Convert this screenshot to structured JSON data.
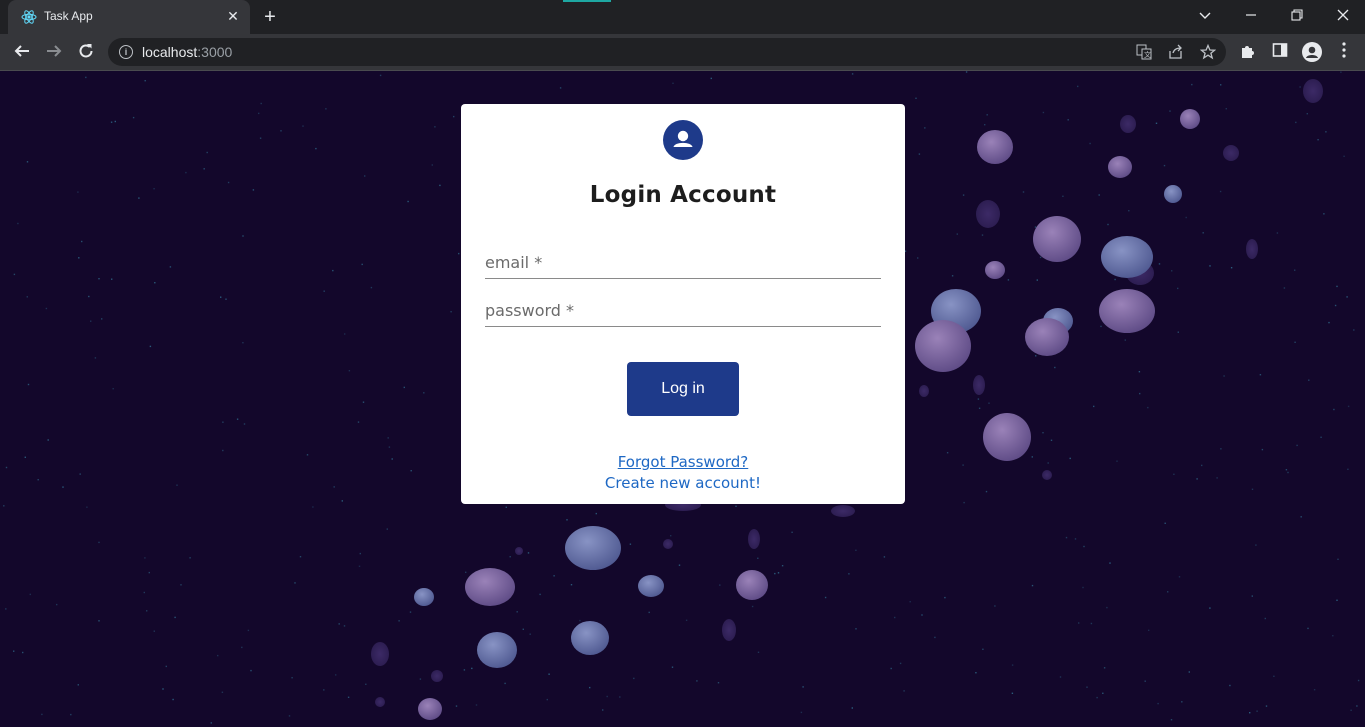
{
  "browser": {
    "tab_title": "Task App",
    "url_host": "localhost",
    "url_port": ":3000",
    "icons": {
      "favicon": "react-icon",
      "close": "close-icon",
      "new_tab": "plus-icon",
      "tab_search": "chevron-down-icon",
      "minimize": "minimize-icon",
      "restore": "restore-icon",
      "window_close": "close-icon",
      "back": "back-arrow-icon",
      "forward": "forward-arrow-icon",
      "reload": "reload-icon",
      "site_info": "info-icon",
      "translate": "translate-icon",
      "share": "share-icon",
      "bookmark": "star-icon",
      "extensions": "puzzle-icon",
      "side_panel": "side-panel-icon",
      "profile": "person-icon",
      "menu": "kebab-menu-icon"
    }
  },
  "login": {
    "title": "Login Account",
    "email_label": "email *",
    "password_label": "password *",
    "submit_label": "Log in",
    "forgot_link": "Forgot Password?",
    "create_link": "Create new account!"
  },
  "colors": {
    "brand": "#1e3a8a",
    "background": "#13072b",
    "link": "#1e68c4"
  }
}
